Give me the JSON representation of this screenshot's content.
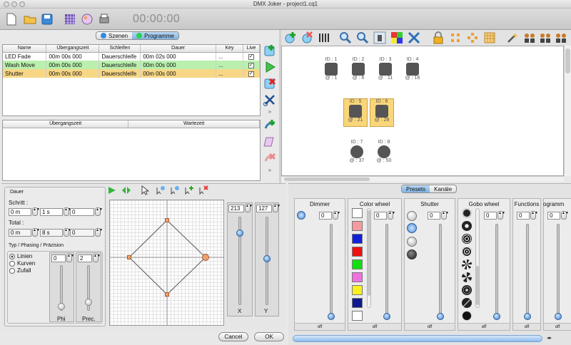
{
  "window": {
    "title": "DMX Joker - project1.cq1"
  },
  "toolbar": {
    "timer": "00:00:00"
  },
  "left_tabs": [
    {
      "label": "Szenen",
      "color": "#2f8fe0"
    },
    {
      "label": "Programme",
      "color": "#2bd24a"
    }
  ],
  "program_table": {
    "headers": [
      "Name",
      "Übergangszeit",
      "Schleifen",
      "Dauer",
      "Key",
      "Live"
    ],
    "rows": [
      {
        "name": "LED Fade",
        "transition": "00m 00s 000",
        "loop": "Dauerschleife",
        "duration": "00m 02s 000",
        "key": "...",
        "live": "✓",
        "bg": "#ffffff"
      },
      {
        "name": "Wash Move",
        "transition": "00m 00s 000",
        "loop": "Dauerschleife",
        "duration": "00m 00s 000",
        "key": "...",
        "live": "✓",
        "bg": "#b9f0ad"
      },
      {
        "name": "Shutter",
        "transition": "00m 00s 000",
        "loop": "Dauerschleife",
        "duration": "00m 00s 000",
        "key": "...",
        "live": "✓",
        "bg": "#f7d786"
      }
    ]
  },
  "step_table": {
    "headers": [
      "Übergangszeit",
      "Wartezeit"
    ]
  },
  "fixtures": [
    {
      "id": "ID : 1",
      "addr": "@ : 1",
      "selected": false
    },
    {
      "id": "ID : 2",
      "addr": "@ : 6",
      "selected": false
    },
    {
      "id": "ID : 3",
      "addr": "@ : 11",
      "selected": false
    },
    {
      "id": "ID : 4",
      "addr": "@ : 16",
      "selected": false
    },
    {
      "id": "ID : 5",
      "addr": "@ : 21",
      "selected": true
    },
    {
      "id": "ID : 6",
      "addr": "@ : 28",
      "selected": true
    },
    {
      "id": "ID : 7",
      "addr": "@ : 37",
      "selected": false
    },
    {
      "id": "ID : 8",
      "addr": "@ : 50",
      "selected": false
    }
  ],
  "dauer": {
    "title": "Dauer",
    "schritt_label": "Schritt :",
    "schritt": [
      "0 m",
      "1 s",
      "0"
    ],
    "total_label": "Total :",
    "total": [
      "0 m",
      "8 s",
      "0"
    ]
  },
  "typ": {
    "title": "Typ / Phasing / Präzision",
    "options": [
      "Linien",
      "Kurven",
      "Zufall"
    ],
    "selected": "Linien",
    "phi_value": "0",
    "prec_value": "2",
    "phi_label": "Phi",
    "prec_label": "Prec."
  },
  "xy": {
    "x_value": "213",
    "y_value": "127",
    "x_label": "X",
    "y_label": "Y"
  },
  "right_tabs": [
    "Presets",
    "Kanäle"
  ],
  "channels": [
    {
      "name": "Dimmer",
      "value": "0",
      "off": "off"
    },
    {
      "name": "Color wheel",
      "value": "0",
      "off": "off"
    },
    {
      "name": "Shutter",
      "value": "0",
      "off": "off"
    },
    {
      "name": "Gobo wheel",
      "value": "0",
      "off": "off"
    },
    {
      "name": "Functions",
      "value": "0",
      "off": "off"
    },
    {
      "name": "ogramm",
      "value": "0",
      "off": "off"
    }
  ],
  "color_swatches": [
    "#ffffff",
    "#f59aa0",
    "#1020d8",
    "#f01010",
    "#10e010",
    "#f070e0",
    "#f8f020",
    "#101890",
    "#ffffff"
  ],
  "buttons": {
    "cancel": "Cancel",
    "ok": "OK"
  }
}
